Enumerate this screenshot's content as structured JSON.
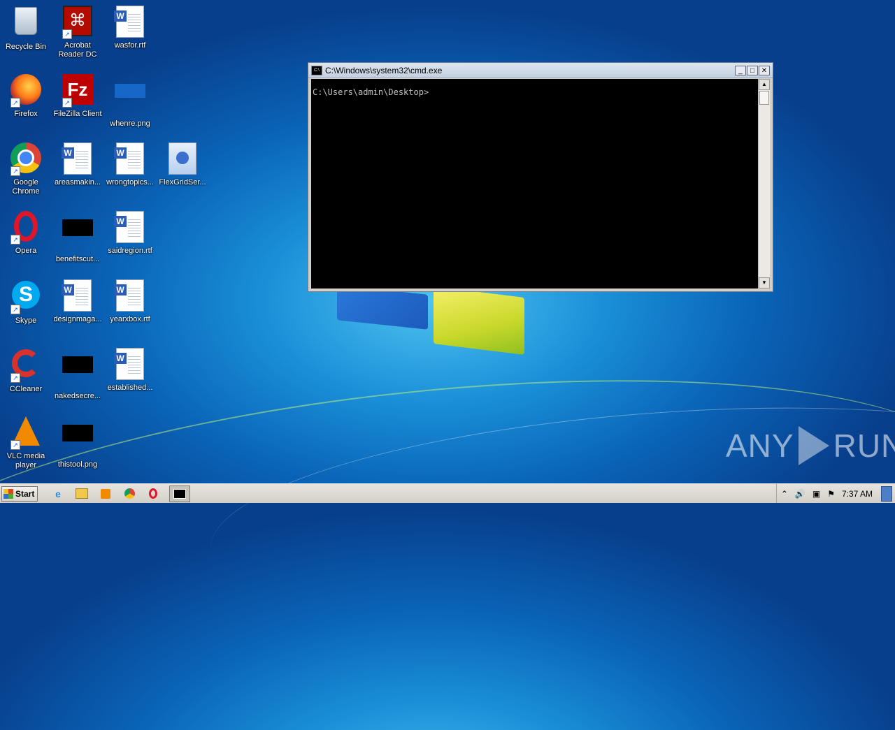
{
  "desktop": {
    "icons": [
      {
        "label": "Recycle Bin"
      },
      {
        "label": "Acrobat Reader DC"
      },
      {
        "label": "wasfor.rtf"
      },
      {
        "label": "Firefox"
      },
      {
        "label": "FileZilla Client"
      },
      {
        "label": "whenre.png"
      },
      {
        "label": "Google Chrome"
      },
      {
        "label": "areasmakin..."
      },
      {
        "label": "wrongtopics..."
      },
      {
        "label": "FlexGridSer..."
      },
      {
        "label": "Opera"
      },
      {
        "label": "benefitscut..."
      },
      {
        "label": "saidregion.rtf"
      },
      {
        "label": "Skype"
      },
      {
        "label": "designmaga..."
      },
      {
        "label": "yearxbox.rtf"
      },
      {
        "label": "CCleaner"
      },
      {
        "label": "nakedsecre..."
      },
      {
        "label": "established..."
      },
      {
        "label": "VLC media player"
      },
      {
        "label": "thistool.png"
      }
    ]
  },
  "cmd_window": {
    "title": "C:\\Windows\\system32\\cmd.exe",
    "prompt": "C:\\Users\\admin\\Desktop>"
  },
  "watermark": {
    "left": "ANY",
    "right": "RUN"
  },
  "taskbar": {
    "start_label": "Start",
    "pinned": [
      "internet-explorer-icon",
      "explorer-icon",
      "media-player-icon",
      "chrome-icon",
      "opera-icon",
      "cmd-icon"
    ],
    "clock": "7:37 AM"
  }
}
